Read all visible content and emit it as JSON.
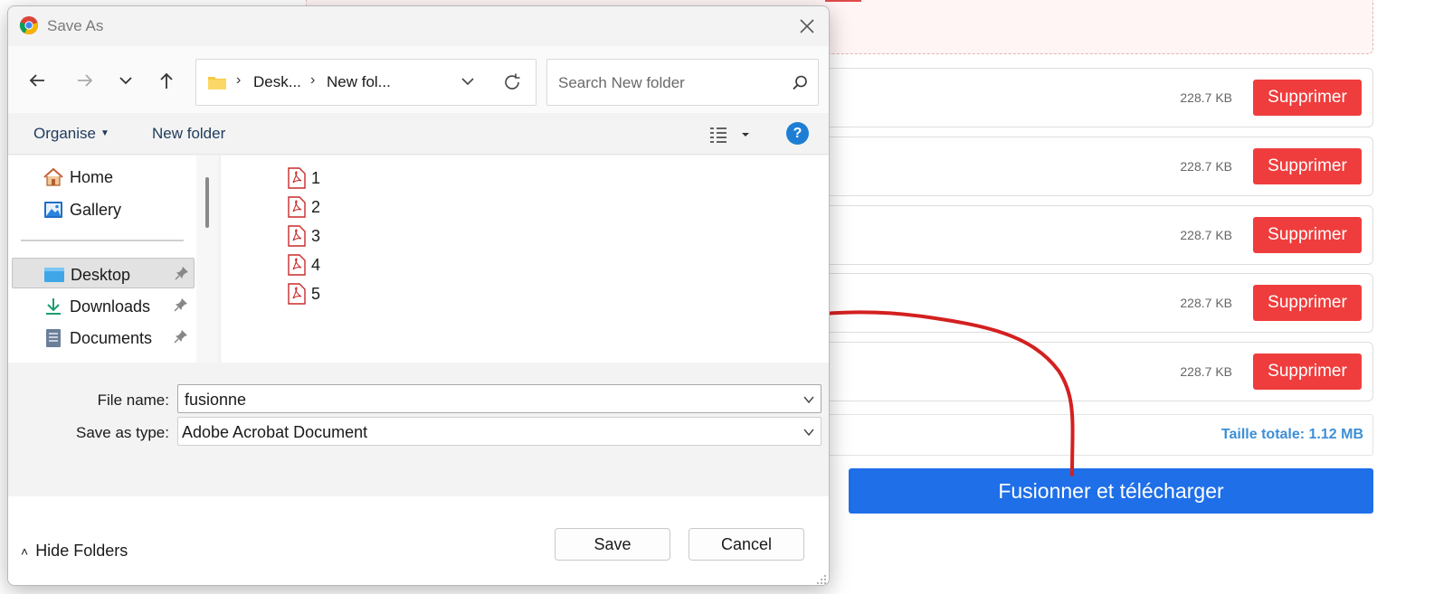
{
  "dialog": {
    "title": "Save As",
    "address": {
      "crumbs": [
        "Desk...",
        "New fol..."
      ]
    },
    "search": {
      "placeholder": "Search New folder"
    },
    "toolbar": {
      "organise": "Organise",
      "new_folder": "New folder",
      "help": "?"
    },
    "nav_items": [
      {
        "label": "Home",
        "icon": "home-icon"
      },
      {
        "label": "Gallery",
        "icon": "gallery-icon"
      },
      {
        "label": "Desktop",
        "icon": "desktop-icon",
        "pinned": true,
        "selected": true
      },
      {
        "label": "Downloads",
        "icon": "download-icon",
        "pinned": true
      },
      {
        "label": "Documents",
        "icon": "documents-icon",
        "pinned": true
      }
    ],
    "files": [
      {
        "name": "1",
        "icon": "pdf-icon"
      },
      {
        "name": "2",
        "icon": "pdf-icon"
      },
      {
        "name": "3",
        "icon": "pdf-icon"
      },
      {
        "name": "4",
        "icon": "pdf-icon"
      },
      {
        "name": "5",
        "icon": "pdf-icon"
      }
    ],
    "form": {
      "file_name_label": "File name:",
      "file_name_value": "fusionne",
      "save_type_label": "Save as type:",
      "save_type_value": "Adobe Acrobat Document"
    },
    "footer": {
      "hide_folders": "Hide Folders",
      "save": "Save",
      "cancel": "Cancel"
    }
  },
  "page": {
    "files": [
      {
        "size": "228.7 KB",
        "delete_label": "Supprimer"
      },
      {
        "size": "228.7 KB",
        "delete_label": "Supprimer"
      },
      {
        "size": "228.7 KB",
        "delete_label": "Supprimer"
      },
      {
        "size": "228.7 KB",
        "delete_label": "Supprimer"
      },
      {
        "size": "228.7 KB",
        "delete_label": "Supprimer"
      }
    ],
    "total_size": "Taille totale: 1.12 MB",
    "merge_button": "Fusionner et télécharger"
  },
  "colors": {
    "delete_button": "#ef3d3d",
    "merge_button": "#1e6fe8",
    "total_text": "#3d8fd6",
    "annotation_arrow": "#d42020",
    "help_icon": "#1e7ed4"
  }
}
